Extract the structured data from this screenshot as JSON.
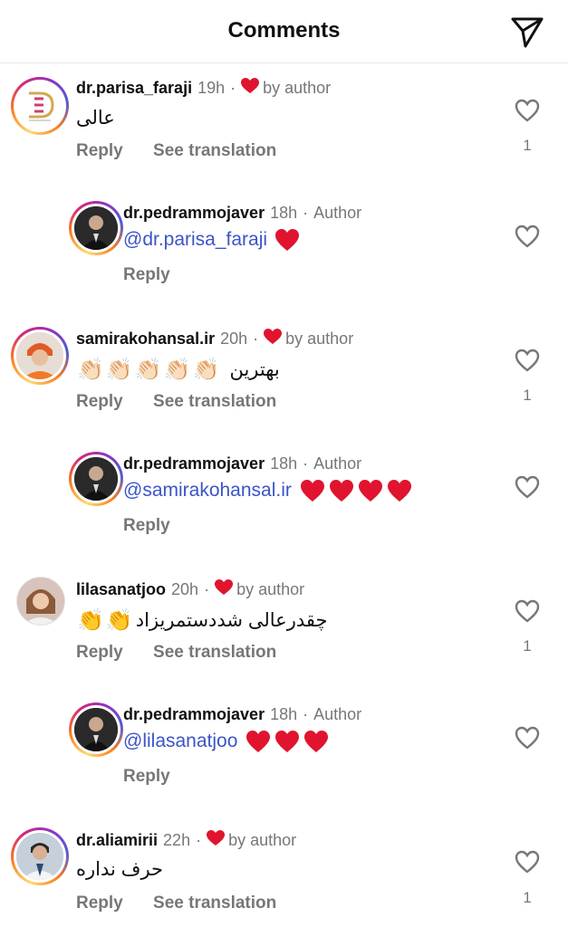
{
  "header": {
    "title": "Comments",
    "send_icon": "paper-plane-icon"
  },
  "colors": {
    "heart": "#e0142e",
    "mention": "#3b54c9",
    "muted": "#777777"
  },
  "comments": [
    {
      "username": "dr.parisa_faraji",
      "time": "19h",
      "badge": "by author",
      "text": "عالی",
      "reply": "Reply",
      "translate": "See translation",
      "likes": "1",
      "reply_item": {
        "username": "dr.pedrammojaver",
        "time": "18h",
        "role": "Author",
        "mention": "@dr.parisa_faraji",
        "reply": "Reply"
      }
    },
    {
      "username": "samirakohansal.ir",
      "time": "20h",
      "badge": "by author",
      "text": "بهترین",
      "reply": "Reply",
      "translate": "See translation",
      "likes": "1",
      "reply_item": {
        "username": "dr.pedrammojaver",
        "time": "18h",
        "role": "Author",
        "mention": "@samirakohansal.ir",
        "reply": "Reply"
      }
    },
    {
      "username": "lilasanatjoo",
      "time": "20h",
      "badge": "by author",
      "text": "چقدرعالی شددستمریزاد",
      "reply": "Reply",
      "translate": "See translation",
      "likes": "1",
      "reply_item": {
        "username": "dr.pedrammojaver",
        "time": "18h",
        "role": "Author",
        "mention": "@lilasanatjoo",
        "reply": "Reply"
      }
    },
    {
      "username": "dr.aliamirii",
      "time": "22h",
      "badge": "by author",
      "text": "حرف نداره",
      "reply": "Reply",
      "translate": "See translation",
      "likes": "1"
    }
  ]
}
